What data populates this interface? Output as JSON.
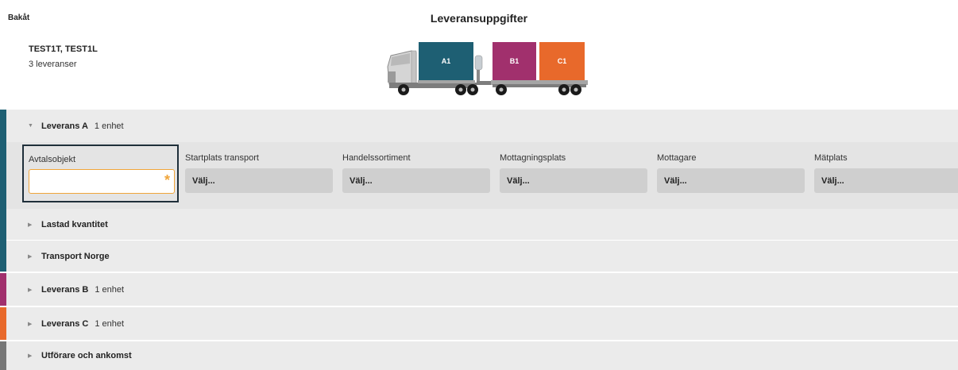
{
  "header": {
    "back_label": "Bakåt",
    "title": "Leveransuppgifter",
    "vehicle_name": "TEST1T, TEST1L",
    "delivery_count": "3 leveranser"
  },
  "truck": {
    "cargo": [
      {
        "label": "A1",
        "color": "#1e5f73"
      },
      {
        "label": "B1",
        "color": "#a1306d"
      },
      {
        "label": "C1",
        "color": "#e8692b"
      }
    ]
  },
  "colors": {
    "leverans_a": "#1e5f73",
    "leverans_b": "#a1306d",
    "leverans_c": "#e8692b",
    "utforare": "#777777",
    "required": "#f0a53a"
  },
  "leverans_a": {
    "label": "Leverans A",
    "units": "1 enhet",
    "fields": {
      "avtalsobjekt": {
        "label": "Avtalsobjekt",
        "value": "",
        "required_mark": "*"
      },
      "startplats": {
        "label": "Startplats transport",
        "value": "Välj..."
      },
      "handelssortiment": {
        "label": "Handelssortiment",
        "value": "Välj..."
      },
      "mottagningsplats": {
        "label": "Mottagningsplats",
        "value": "Välj..."
      },
      "mottagare": {
        "label": "Mottagare",
        "value": "Välj..."
      },
      "matplats": {
        "label": "Mätplats",
        "value": "Välj..."
      }
    },
    "subsections": [
      {
        "label": "Lastad kvantitet"
      },
      {
        "label": "Transport Norge"
      }
    ]
  },
  "leverans_b": {
    "label": "Leverans B",
    "units": "1 enhet"
  },
  "leverans_c": {
    "label": "Leverans C",
    "units": "1 enhet"
  },
  "utforare": {
    "label": "Utförare och ankomst"
  }
}
